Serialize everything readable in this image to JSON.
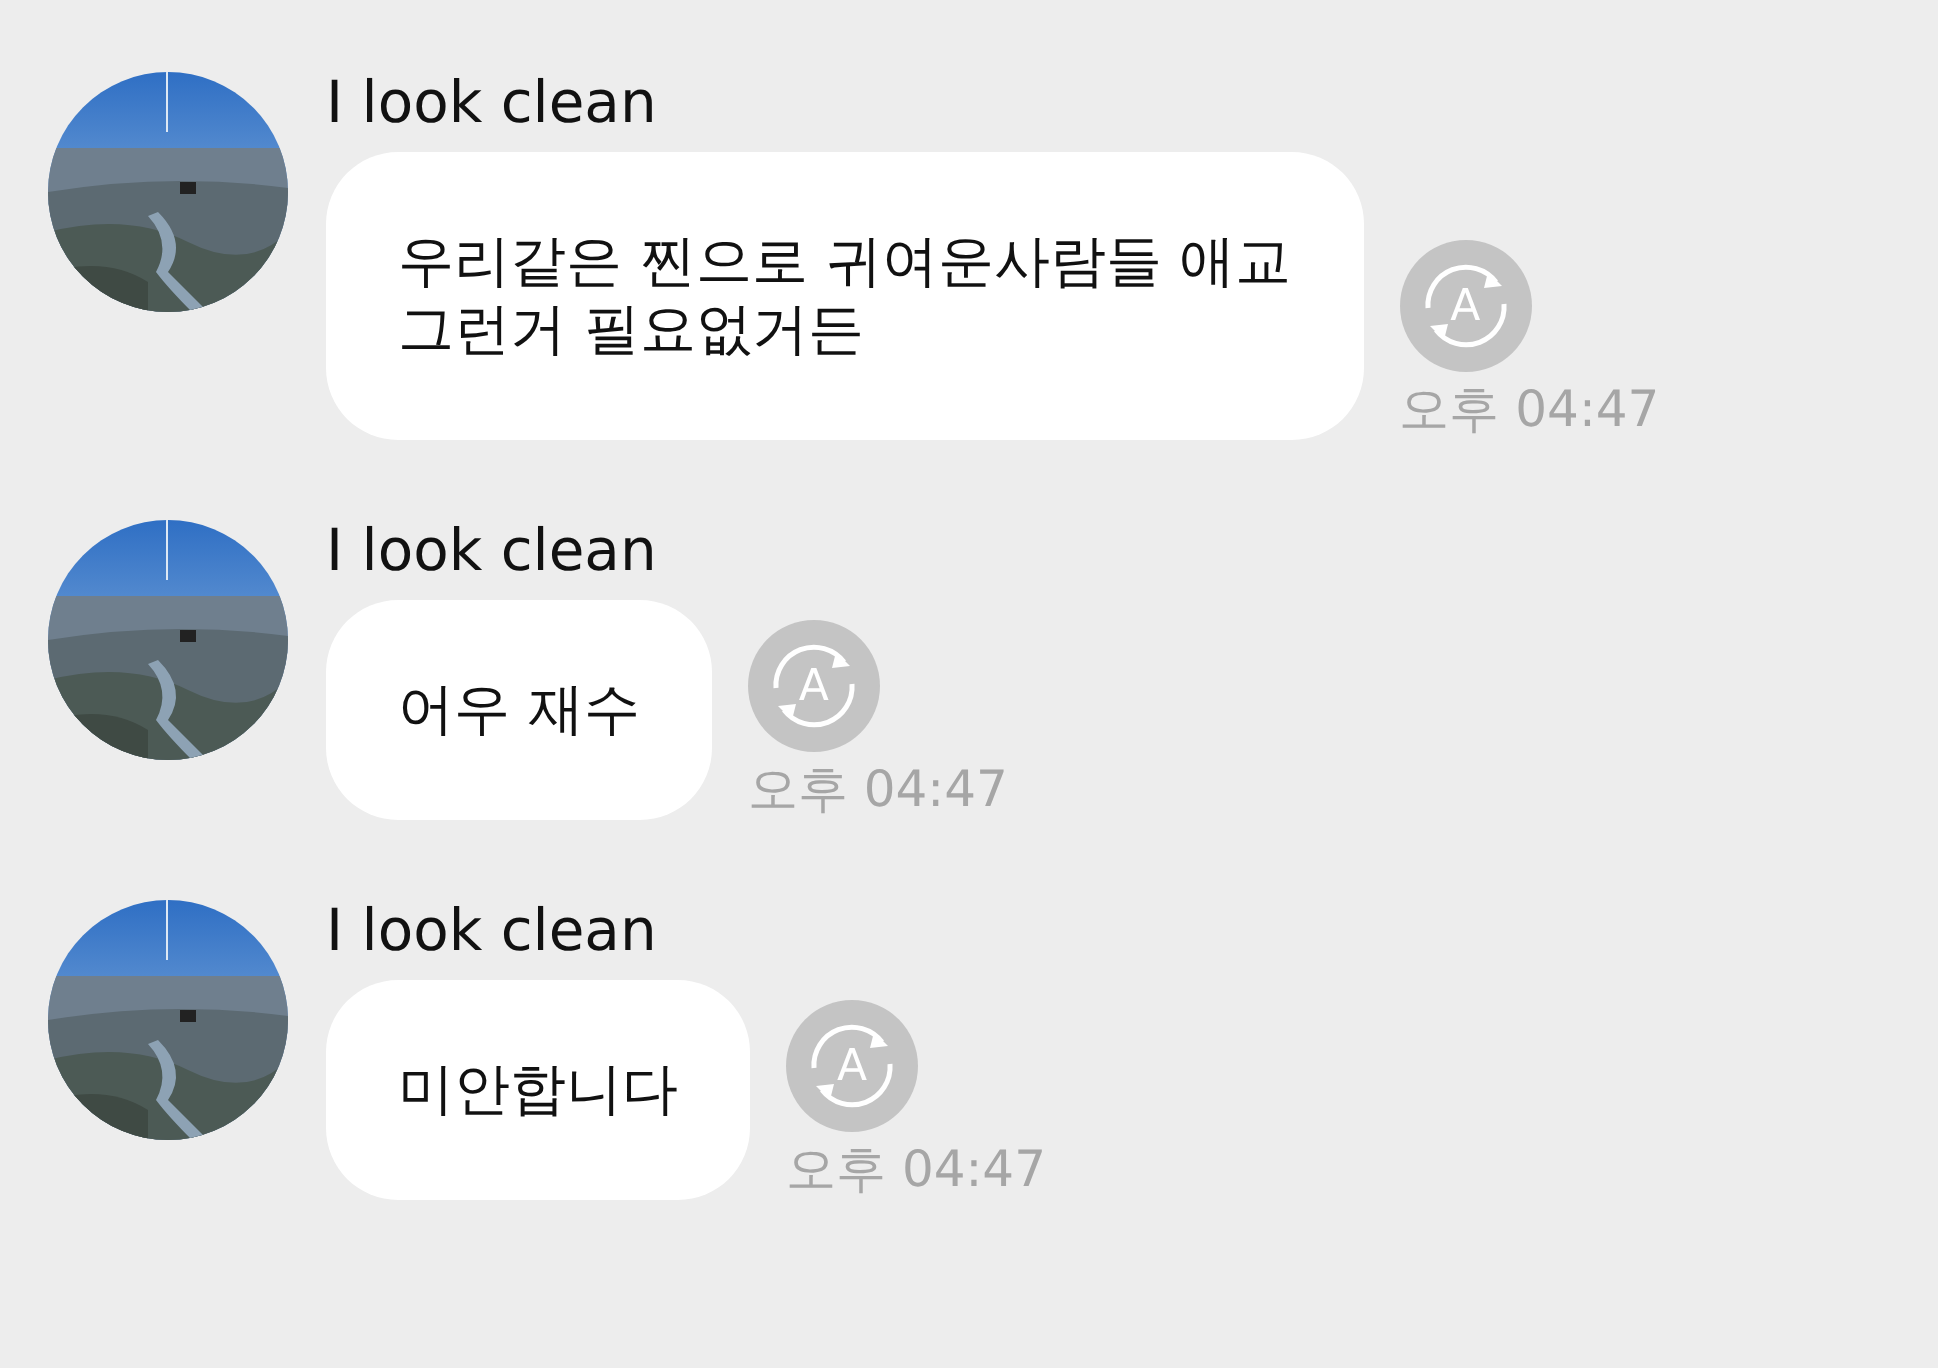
{
  "messages": [
    {
      "kind": "picture",
      "sender": "I look clean",
      "lines": [
        "우리같은 찐으로 귀여운사람들 애교",
        "그런거 필요없거든"
      ],
      "translate_glyph": "A",
      "time": "오후 04:47"
    },
    {
      "kind": "picture",
      "sender": "I look clean",
      "lines": [
        "어우 재수"
      ],
      "translate_glyph": "A",
      "time": "오후 04:47"
    },
    {
      "kind": "picture",
      "sender": "I look clean",
      "lines": [
        "미안합니다"
      ],
      "translate_glyph": "A",
      "time": "오후 04:47"
    }
  ]
}
